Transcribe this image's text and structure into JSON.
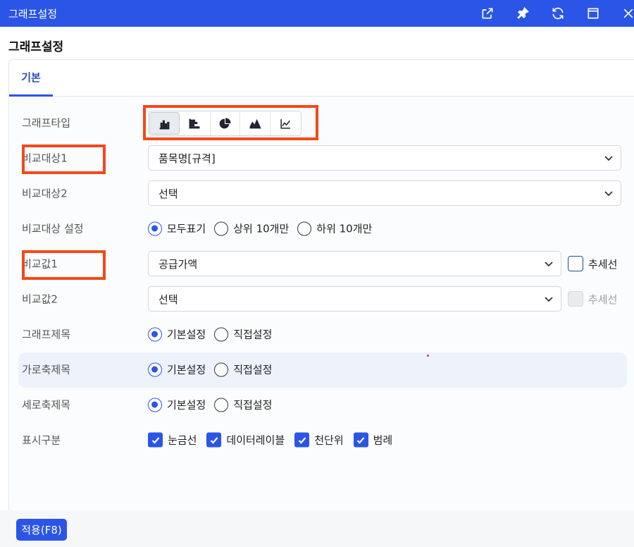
{
  "window": {
    "title": "그래프설정",
    "icons": [
      "external-link-icon",
      "pin-icon",
      "refresh-icon",
      "maximize-icon",
      "close-icon"
    ]
  },
  "page_title": "그래프설정",
  "tabs": [
    {
      "label": "기본",
      "active": true
    }
  ],
  "form": {
    "chart_type": {
      "label": "그래프타입",
      "options": [
        "bar-chart-icon",
        "horizontal-bar-chart-icon",
        "pie-chart-icon",
        "area-chart-icon",
        "line-chart-icon"
      ],
      "selected": "bar-chart-icon"
    },
    "compare_target1": {
      "label": "비교대상1",
      "value": "품목명[규격]"
    },
    "compare_target2": {
      "label": "비교대상2",
      "value": "선택"
    },
    "compare_setting": {
      "label": "비교대상 설정",
      "options": [
        "모두표기",
        "상위 10개만",
        "하위 10개만"
      ],
      "selected": "모두표기"
    },
    "compare_value1": {
      "label": "비교값1",
      "value": "공급가액",
      "trendline_label": "추세선",
      "trendline_checked": false
    },
    "compare_value2": {
      "label": "비교값2",
      "value": "선택",
      "trendline_label": "추세선",
      "trendline_disabled": true
    },
    "graph_title": {
      "label": "그래프제목",
      "options": [
        "기본설정",
        "직접설정"
      ],
      "selected": "기본설정"
    },
    "x_axis_title": {
      "label": "가로축제목",
      "options": [
        "기본설정",
        "직접설정"
      ],
      "selected": "기본설정"
    },
    "y_axis_title": {
      "label": "세로축제목",
      "options": [
        "기본설정",
        "직접설정"
      ],
      "selected": "기본설정"
    },
    "display": {
      "label": "표시구분",
      "options": [
        {
          "label": "눈금선",
          "checked": true
        },
        {
          "label": "데이터레이블",
          "checked": true
        },
        {
          "label": "천단위",
          "checked": true
        },
        {
          "label": "범례",
          "checked": true
        }
      ]
    }
  },
  "footer": {
    "apply_label": "적용(F8)"
  },
  "colors": {
    "accent": "#2b55e6",
    "highlight_box": "#f04a1c",
    "row_highlight": "#edf2fb"
  }
}
